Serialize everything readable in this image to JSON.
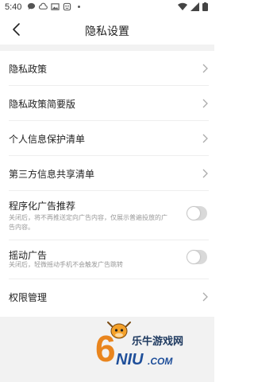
{
  "status": {
    "time": "5:40"
  },
  "header": {
    "title": "隐私设置"
  },
  "menu": {
    "privacy_policy": "隐私政策",
    "privacy_summary": "隐私政策简要版",
    "personal_info_list": "个人信息保护清单",
    "third_party_list": "第三方信息共享清单",
    "programmatic_ads": {
      "label": "程序化广告推荐",
      "desc": "关闭后，将不再推送定向广告内容，仅展示普遍投放的广告内容。",
      "enabled": false
    },
    "shake_ads": {
      "label": "摇动广告",
      "desc": "关闭后，轻微摇动手机不会触发广告跳转",
      "enabled": false
    },
    "permissions": "权限管理"
  },
  "watermark": {
    "text": "乐牛游戏网",
    "logo": "6NIU.COM"
  },
  "colors": {
    "toggle_off": "#d9d9d9",
    "separator": "#f2f2f2",
    "desc_text": "#999999"
  }
}
